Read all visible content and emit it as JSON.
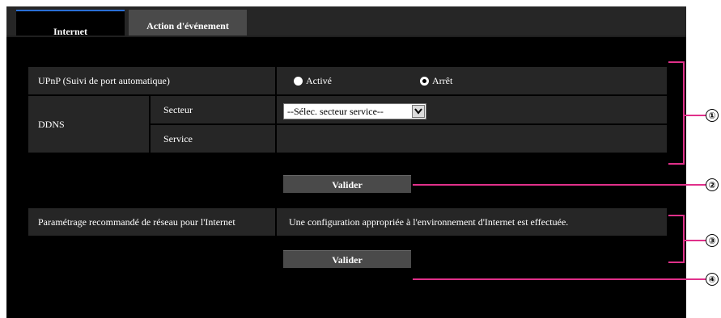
{
  "tabs": [
    {
      "label": "Internet",
      "active": true
    },
    {
      "label": "Action d'événement",
      "active": false
    }
  ],
  "upnp": {
    "label": "UPnP (Suivi de port automatique)",
    "options": [
      {
        "label": "Activé",
        "selected": false
      },
      {
        "label": "Arrêt",
        "selected": true
      }
    ]
  },
  "ddns": {
    "label": "DDNS",
    "secteur_label": "Secteur",
    "secteur_value": "--Sélec. secteur service--",
    "service_label": "Service",
    "service_value": ""
  },
  "buttons": {
    "validate1": "Valider",
    "validate2": "Valider"
  },
  "recommended": {
    "label": "Paramétrage recommandé de réseau pour l'Internet",
    "description": "Une configuration appropriée à l'environnement d'Internet est effectuée."
  },
  "callouts": [
    "①",
    "②",
    "③",
    "④"
  ],
  "colors": {
    "background": "#000000",
    "cell": "#262626",
    "tab_active_accent": "#2a6fd6",
    "button": "#4a4a4a",
    "annotation_line": "#e0308a"
  }
}
